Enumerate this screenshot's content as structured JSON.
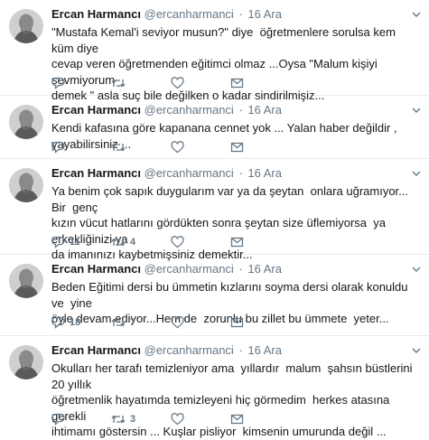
{
  "tweets": [
    {
      "name": "Ercan Harmancı",
      "handle": "@ercanharmanci",
      "separator": "·",
      "date": "16 Ara",
      "text": "\"Mustafa Kemal'i seviyor musun?\" diye  öğretmenlere sorulsa kem küm diye\ncevap veren öğretmenden eğitimci olmaz ...Oysa \"Malum kişiyi sevmiyorum\ndemek \" asla suç bile değilken o kadar sindirilmişiz...",
      "replies": "",
      "retweets": "",
      "likes": ""
    },
    {
      "name": "Ercan Harmancı",
      "handle": "@ercanharmanci",
      "separator": "·",
      "date": "16 Ara",
      "text": "Kendi kafasına göre kapanana cennet yok ... Yalan haber değildir , yayabilirsiniz ...",
      "replies": "",
      "retweets": "",
      "likes": ""
    },
    {
      "name": "Ercan Harmancı",
      "handle": "@ercanharmanci",
      "separator": "·",
      "date": "16 Ara",
      "text": "Ya benim çok sapık duygularım var ya da şeytan  onlara uğramıyor... Bir  genç\nkızın vücut hatlarını gördükten sonra şeytan size üflemiyorsa  ya erkekliğinizi ya\nda imanınızı kaybetmişsiniz demektir...",
      "replies": "11",
      "retweets": "4",
      "likes": ""
    },
    {
      "name": "Ercan Harmancı",
      "handle": "@ercanharmanci",
      "separator": "·",
      "date": "16 Ara",
      "text": "Beden Eğitimi dersi bu ümmetin kızlarını soyma dersi olarak konuldu ve  yine\nöyle devam ediyor...Hem de  zorunlu bu zillet bu ümmete  yeter...",
      "replies": "18",
      "retweets": "7",
      "likes": ""
    },
    {
      "name": "Ercan Harmancı",
      "handle": "@ercanharmanci",
      "separator": "·",
      "date": "16 Ara",
      "text": "Okulları her tarafı temizleniyor ama  yıllardır  malum  şahsın büstlerini  20 yıllık\nöğretmenlik hayatımda temizleyeni hiç görmedim  herkes atasına  gerekli\nihtimamı göstersin ... Kuşlar pisliyor  kimsenin umurunda değil ...",
      "replies": "",
      "retweets": "3",
      "likes": ""
    }
  ],
  "icons": {
    "reply": "reply-icon",
    "retweet": "retweet-icon",
    "like": "heart-icon",
    "dm": "envelope-icon",
    "caret": "chevron-down-icon"
  },
  "colors": {
    "text": "#14171a",
    "muted": "#657786",
    "divider": "#e6ecf0"
  }
}
